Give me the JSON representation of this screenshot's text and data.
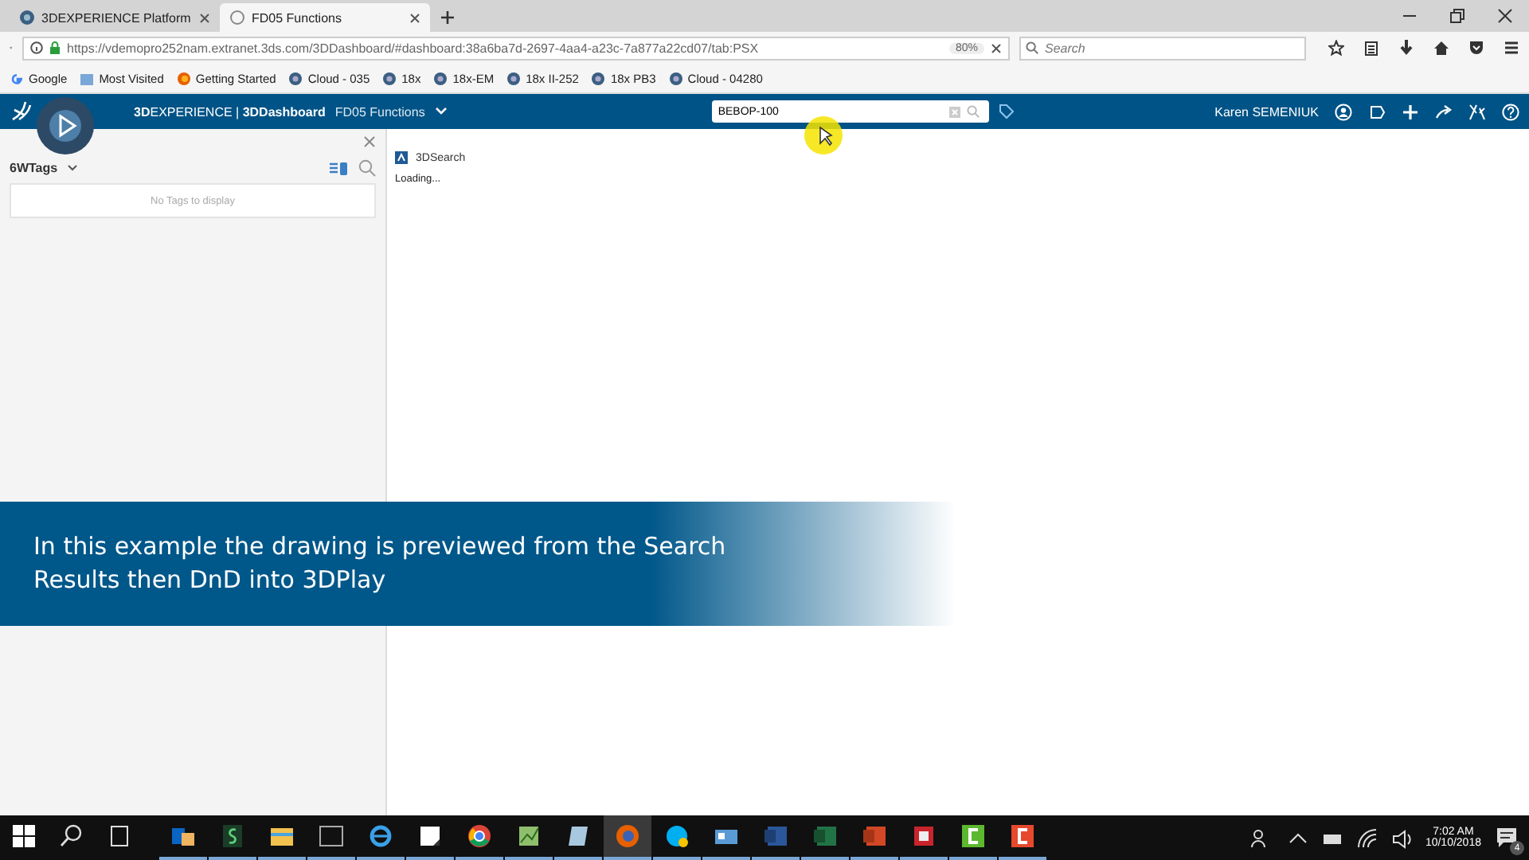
{
  "browser": {
    "tabs": [
      {
        "label": "3DEXPERIENCE Platform",
        "selected": false
      },
      {
        "label": "FD05 Functions",
        "selected": true
      }
    ],
    "address": "https://vdemopro252nam.extranet.3ds.com/3DDashboard/#dashboard:38a6ba7d-2697-4aa4-a23c-7a877a22cd07/tab:PSX",
    "zoom": "80%",
    "search_placeholder": "Search",
    "bookmarks": [
      {
        "label": "Google",
        "kind": "google"
      },
      {
        "label": "Most Visited",
        "kind": "folder"
      },
      {
        "label": "Getting Started",
        "kind": "firefox"
      },
      {
        "label": "Cloud - 035",
        "kind": "platform"
      },
      {
        "label": "18x",
        "kind": "platform"
      },
      {
        "label": "18x-EM",
        "kind": "platform"
      },
      {
        "label": "18x II-252",
        "kind": "platform"
      },
      {
        "label": "18x PB3",
        "kind": "platform"
      },
      {
        "label": "Cloud - 04280",
        "kind": "platform"
      }
    ]
  },
  "app": {
    "brand": "**3D**EXPERIENCE | **3DDashboard**",
    "dashboard": "FD05 Functions",
    "search_value": "BEBOP-100",
    "user": "Karen SEMENIUK"
  },
  "tags_panel": {
    "title": "6WTags",
    "empty": "No Tags to display"
  },
  "widget": {
    "title": "3DSearch",
    "status": "Loading..."
  },
  "caption": {
    "lines": [
      "In this example the drawing is previewed from the Search",
      "Results then DnD into 3DPlay"
    ]
  },
  "taskbar": {
    "apps": [
      {
        "kind": "outlook",
        "selected": false
      },
      {
        "kind": "green-s",
        "selected": false
      },
      {
        "kind": "explorer",
        "selected": false
      },
      {
        "kind": "terminal",
        "selected": false
      },
      {
        "kind": "ie",
        "selected": false
      },
      {
        "kind": "notes",
        "selected": false
      },
      {
        "kind": "chrome",
        "selected": false
      },
      {
        "kind": "chart",
        "selected": false
      },
      {
        "kind": "pad",
        "selected": false
      },
      {
        "kind": "firefox",
        "selected": true
      },
      {
        "kind": "skype",
        "selected": false
      },
      {
        "kind": "card",
        "selected": false
      },
      {
        "kind": "word",
        "selected": false
      },
      {
        "kind": "excel",
        "selected": false
      },
      {
        "kind": "powerpoint",
        "selected": false
      },
      {
        "kind": "solidworks",
        "selected": false
      },
      {
        "kind": "camtasia-green",
        "selected": false
      },
      {
        "kind": "camtasia-red",
        "selected": false
      }
    ],
    "time": "7:02 AM",
    "date": "10/10/2018",
    "notifications": "4"
  }
}
